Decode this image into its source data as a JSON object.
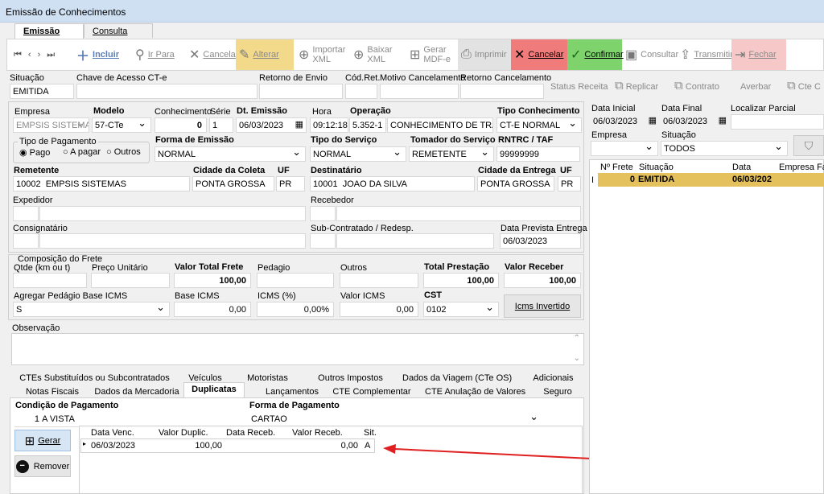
{
  "window": {
    "title": "Emissão de Conhecimentos"
  },
  "tabs": [
    {
      "label": "Emissão"
    },
    {
      "label": "Consulta"
    }
  ],
  "toolbar": {
    "incluir": "Incluir",
    "ir_para": "Ir Para",
    "cancelar_edit": "Cancelar",
    "alterar": "Alterar",
    "importar": "Importar",
    "importar2": "XML",
    "baixar": "Baixar",
    "baixar2": "XML",
    "gerar": "Gerar",
    "gerar2": "MDF-e",
    "imprimir": "Imprimir",
    "cancelar": "Cancelar",
    "confirmar": "Confirmar",
    "consultar": "Consultar",
    "transmitir": "Transmitir",
    "fechar": "Fechar"
  },
  "row2": {
    "situacao_label": "Situação",
    "situacao": "EMITIDA",
    "chave_label": "Chave de Acesso CT-e",
    "retorno_label": "Retorno de Envio",
    "codret_label": "Cód.Ret.",
    "motivo_label": "Motivo Cancelamento",
    "retcanc_label": "Retorno Cancelamento",
    "status_receita": "Status Receita",
    "replicar": "Replicar",
    "contrato": "Contrato",
    "averbar": "Averbar",
    "cte": "Cte C"
  },
  "form": {
    "empresa_label": "Empresa",
    "empresa": "EMPSIS SISTEMA",
    "modelo_label": "Modelo",
    "modelo": "57-CTe",
    "conhecimento_label": "Conhecimento",
    "conhecimento": "0",
    "serie_label": "Série",
    "serie": "1",
    "dtemissao_label": "Dt. Emissão",
    "dtemissao": "06/03/2023",
    "hora_label": "Hora",
    "hora": "09:12:18",
    "operacao_label": "Operação",
    "operacao_cod": "5.352-1",
    "operacao": "CONHECIMENTO DE TRANSP",
    "tipocon_label": "Tipo Conhecimento",
    "tipocon": "CT-E NORMAL",
    "tipopag_label": "Tipo de Pagamento",
    "pago": "Pago",
    "apagar": "A pagar",
    "outros": "Outros",
    "formaemi_label": "Forma de Emissão",
    "formaemi": "NORMAL",
    "tiposerv_label": "Tipo do Serviço",
    "tiposerv": "NORMAL",
    "tomador_label": "Tomador do Serviço",
    "tomador": "REMETENTE",
    "rntrc_label": "RNTRC / TAF",
    "rntrc": "99999999",
    "remetente_label": "Remetente",
    "remetente_cod": "10002",
    "remetente": "EMPSIS SISTEMAS",
    "cidcoleta_label": "Cidade da Coleta",
    "cidcoleta": "PONTA GROSSA",
    "uf_label": "UF",
    "uf1": "PR",
    "destinatario_label": "Destinatário",
    "dest_cod": "10001",
    "destinatario": "JOAO DA SILVA",
    "cident_label": "Cidade da Entrega",
    "cident": "PONTA GROSSA",
    "uf2_label": "UF",
    "uf2": "PR",
    "expedidor_label": "Expedidor",
    "recebedor_label": "Recebedor",
    "consignatario_label": "Consignatário",
    "subcontratado_label": "Sub-Contratado / Redesp.",
    "dataprev_label": "Data Prevista Entrega",
    "dataprev": "06/03/2023"
  },
  "frete": {
    "group": "Composição do Frete",
    "qtde_label": "Qtde (km ou t)",
    "preco_label": "Preço Unitário",
    "vtf_label": "Valor Total Frete",
    "vtf": "100,00",
    "pedagio_label": "Pedagio",
    "outros_label": "Outros",
    "totprest_label": "Total Prestação",
    "totprest": "100,00",
    "vrec_label": "Valor Receber",
    "vrec": "100,00",
    "agregar_label": "Agregar Pedágio Base ICMS",
    "agregar": "S",
    "baseicms_label": "Base ICMS",
    "baseicms": "0,00",
    "icmsp_label": "ICMS (%)",
    "icmsp": "0,00%",
    "vicms_label": "Valor ICMS",
    "vicms": "0,00",
    "cst_label": "CST",
    "cst": "0102",
    "icmsinv": "Icms Invertido",
    "obs_label": "Observação"
  },
  "bottomtabs": {
    "row1": [
      "CTEs Substituídos ou Subcontratados",
      "Veículos",
      "Motoristas",
      "Outros Impostos",
      "Dados da Viagem (CTe OS)",
      "Adicionais"
    ],
    "row2": [
      "Notas Fiscais",
      "Dados da Mercadoria",
      "Duplicatas",
      "Lançamentos",
      "CTE Complementar",
      "CTE Anulação de Valores",
      "Seguro"
    ]
  },
  "dup": {
    "cond_label": "Condição de Pagamento",
    "cond_cod": "1",
    "cond": "A VISTA",
    "forma_label": "Forma de Pagamento",
    "forma": "CARTAO",
    "gerar": "Gerar",
    "remover": "Remover",
    "cols": [
      "Data Venc.",
      "Valor Duplic.",
      "Data Receb.",
      "Valor Receb.",
      "Sit."
    ],
    "row": [
      "06/03/2023",
      "100,00",
      "",
      "0,00",
      "A"
    ]
  },
  "right": {
    "dataini_label": "Data Inicial",
    "dataini": "06/03/2023",
    "datafim_label": "Data Final",
    "datafim": "06/03/2023",
    "localizar_label": "Localizar Parcial",
    "empresa_label": "Empresa",
    "situacao_label": "Situação",
    "situacao": "TODOS",
    "cols": [
      "Nº Frete",
      "Situação",
      "Data",
      "Empresa Fat"
    ],
    "row": [
      "0",
      "EMITIDA",
      "06/03/202",
      ""
    ],
    "row_marker": "I"
  },
  "colors": {
    "accent": "#e5c15d",
    "arrow": "#e02020",
    "confirm": "#7fd36d",
    "cancel": "#f07b7b"
  }
}
